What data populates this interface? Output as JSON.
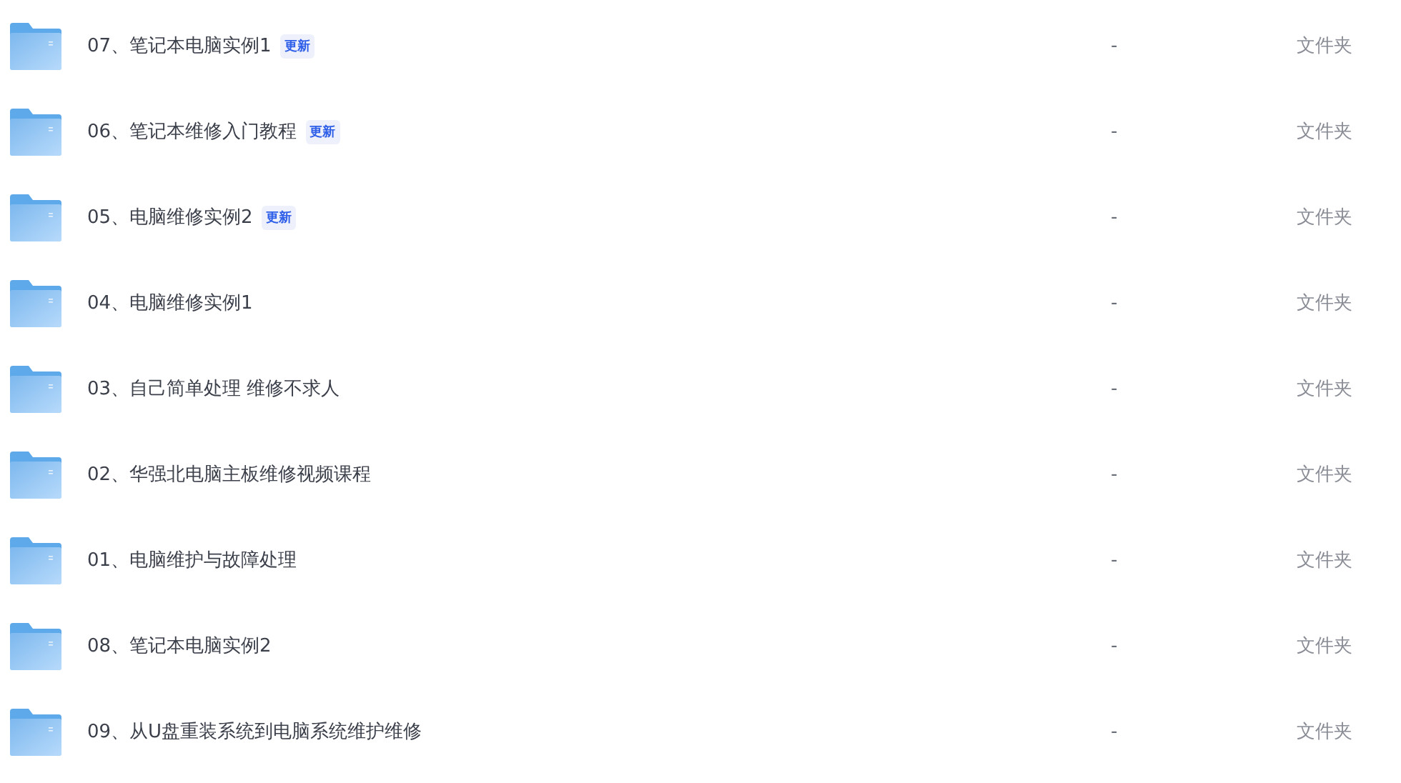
{
  "files": [
    {
      "name": "07、笔记本电脑实例1",
      "badge": "更新",
      "size": "-",
      "type": "文件夹"
    },
    {
      "name": "06、笔记本维修入门教程",
      "badge": "更新",
      "size": "-",
      "type": "文件夹"
    },
    {
      "name": "05、电脑维修实例2",
      "badge": "更新",
      "size": "-",
      "type": "文件夹"
    },
    {
      "name": "04、电脑维修实例1",
      "size": "-",
      "type": "文件夹"
    },
    {
      "name": "03、自己简单处理 维修不求人",
      "size": "-",
      "type": "文件夹"
    },
    {
      "name": "02、华强北电脑主板维修视频课程",
      "size": "-",
      "type": "文件夹"
    },
    {
      "name": "01、电脑维护与故障处理",
      "size": "-",
      "type": "文件夹"
    },
    {
      "name": "08、笔记本电脑实例2",
      "size": "-",
      "type": "文件夹"
    },
    {
      "name": "09、从U盘重装系统到电脑系统维护维修",
      "size": "-",
      "type": "文件夹"
    }
  ]
}
